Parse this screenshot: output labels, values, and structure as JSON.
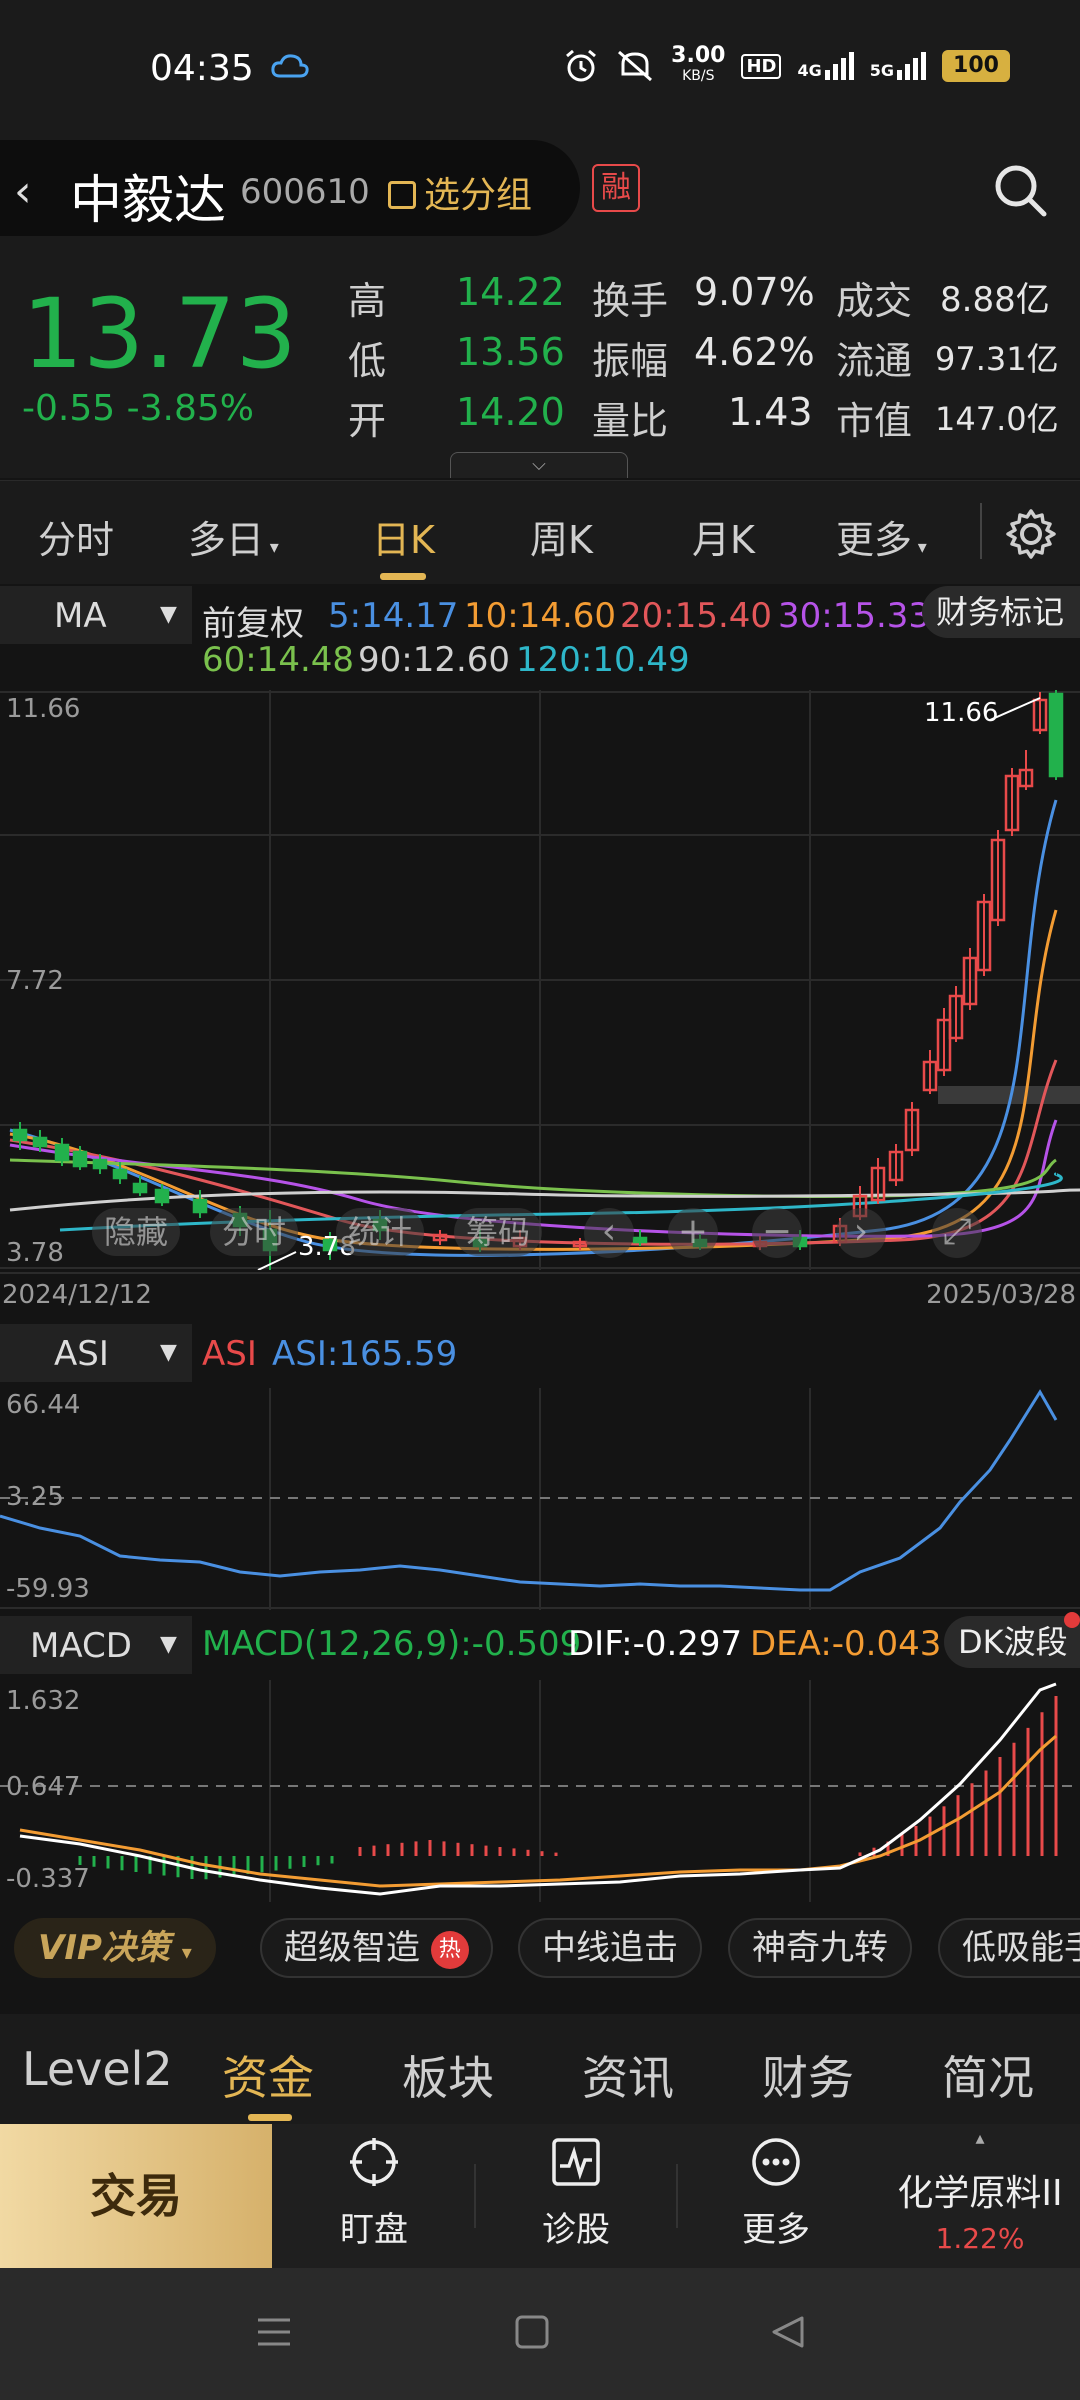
{
  "status_bar": {
    "time": "04:35",
    "net_speed_top": "3.00",
    "net_speed_unit": "KB/S",
    "hd_badge": "HD",
    "sig1": "4G",
    "sig2": "5G",
    "battery": "100",
    "icons": [
      "cloud-icon",
      "alarm-icon",
      "mute-icon",
      "signal-icon",
      "battery-icon"
    ]
  },
  "header": {
    "stock_name": "中毅达",
    "stock_code": "600610",
    "group_button": "选分组",
    "margin_badge": "融"
  },
  "quote": {
    "price": "13.73",
    "change": "-0.55",
    "change_pct": "-3.85%",
    "high_label": "高",
    "high": "14.22",
    "low_label": "低",
    "low": "13.56",
    "open_label": "开",
    "open": "14.20",
    "turnover_label": "换手",
    "turnover": "9.07%",
    "amplitude_label": "振幅",
    "amplitude": "4.62%",
    "vol_ratio_label": "量比",
    "vol_ratio": "1.43",
    "amount_label": "成交",
    "amount": "8.88亿",
    "float_label": "流通",
    "float_cap": "97.31亿",
    "mcap_label": "市值",
    "mcap": "147.0亿",
    "expand_icon": "chevron-down-icon"
  },
  "period_tabs": [
    "分时",
    "多日",
    "日K",
    "周K",
    "月K",
    "更多"
  ],
  "period_tabs_active": "日K",
  "ma_legend": {
    "indicator": "MA",
    "adjust": "前复权",
    "ma5": "5:14.17",
    "ma10": "10:14.60",
    "ma20": "20:15.40",
    "ma30": "30:15.33",
    "ma60": "60:14.48",
    "ma90": "90:12.60",
    "ma120": "120:10.49",
    "finance_button": "财务标记",
    "colors": {
      "ma5": "#4a90e2",
      "ma10": "#f39c33",
      "ma20": "#e2575a",
      "ma30": "#b653e8",
      "ma60": "#7ac14d",
      "ma90": "#d0d0d0",
      "ma120": "#2eb7c9"
    }
  },
  "kchart": {
    "y_top": "11.66",
    "y_mid": "7.72",
    "y_bottom": "3.78",
    "high_marker": "11.66",
    "low_marker": "3.78",
    "date_start": "2024/12/12",
    "date_end": "2025/03/28",
    "overlay_buttons": [
      "隐藏",
      "分时",
      "统计",
      "筹码"
    ]
  },
  "asi": {
    "indicator": "ASI",
    "name": "ASI",
    "value": "ASI:165.59",
    "y_top": "66.44",
    "y_mid": "3.25",
    "y_bottom": "-59.93"
  },
  "macd": {
    "indicator": "MACD",
    "params": "MACD(12,26,9):-0.509",
    "dif": "DIF:-0.297",
    "dea": "DEA:-0.043",
    "wave_button": "DK波段",
    "y_top": "1.632",
    "y_mid": "0.647",
    "y_bottom": "-0.337"
  },
  "chips": {
    "vip": "VIP决策",
    "items": [
      "超级智造",
      "中线追击",
      "神奇九转",
      "低吸能手"
    ],
    "hot_badge": "热"
  },
  "info_tabs": [
    "Level2",
    "资金",
    "板块",
    "资讯",
    "财务",
    "简况"
  ],
  "info_tabs_active": "资金",
  "actions": {
    "trade": "交易",
    "watch": "盯盘",
    "diagnose": "诊股",
    "more": "更多",
    "sector_name": "化学原料II",
    "sector_pct": "1.22%"
  }
}
